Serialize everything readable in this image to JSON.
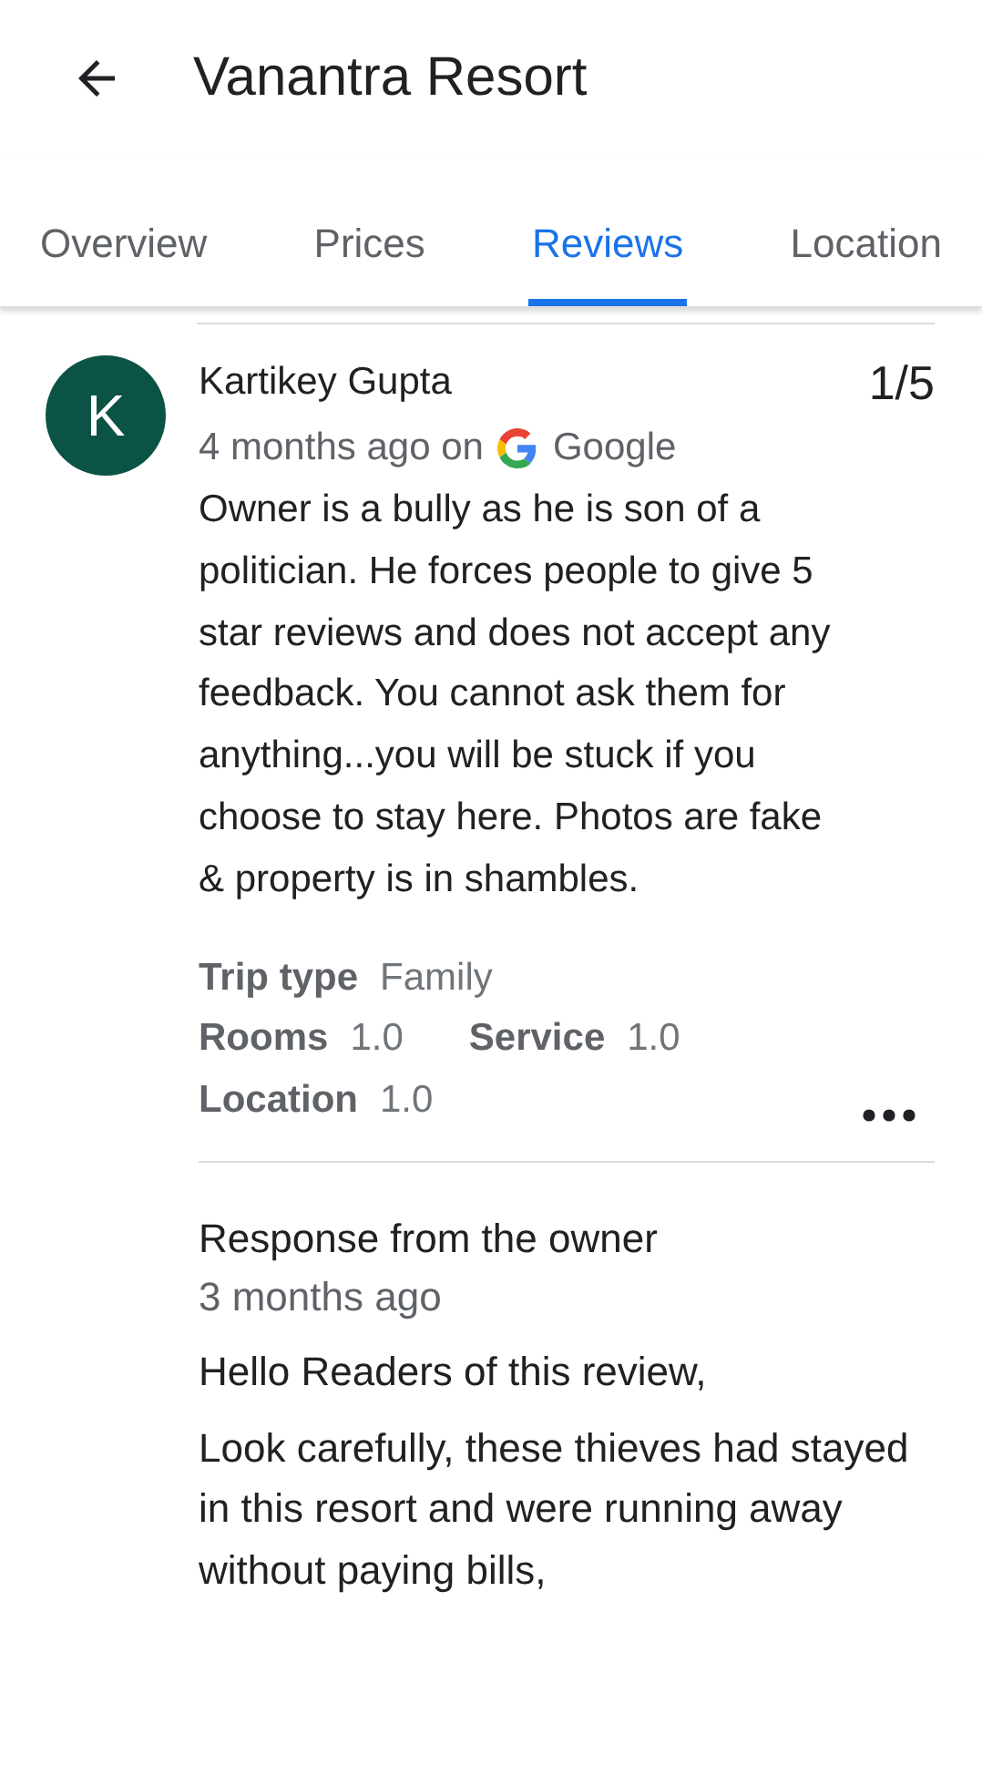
{
  "header": {
    "title": "Vanantra Resort"
  },
  "tabs": [
    {
      "label": "Overview",
      "selected": false
    },
    {
      "label": "Prices",
      "selected": false
    },
    {
      "label": "Reviews",
      "selected": true
    },
    {
      "label": "Location",
      "selected": false
    }
  ],
  "review": {
    "avatar_letter": "K",
    "author": "Kartikey Gupta",
    "rating": "1/5",
    "time": "4 months ago on",
    "source": "Google",
    "text": "Owner is a bully as he is son of a politician. He forces people to give 5 star reviews and does not accept any feedback. You cannot ask them for anything...you will be stuck if you choose to stay here. Photos are fake & property is in shambles.",
    "details": [
      [
        {
          "label": "Trip type",
          "value": "Family"
        }
      ],
      [
        {
          "label": "Rooms",
          "value": "1.0"
        },
        {
          "label": "Service",
          "value": "1.0"
        }
      ],
      [
        {
          "label": "Location",
          "value": "1.0"
        }
      ]
    ]
  },
  "owner_response": {
    "title": "Response from the owner",
    "time": "3 months ago",
    "paragraphs": [
      "Hello Readers of this review,",
      "Look carefully, these thieves had stayed in this resort and were running away without paying bills,"
    ]
  }
}
